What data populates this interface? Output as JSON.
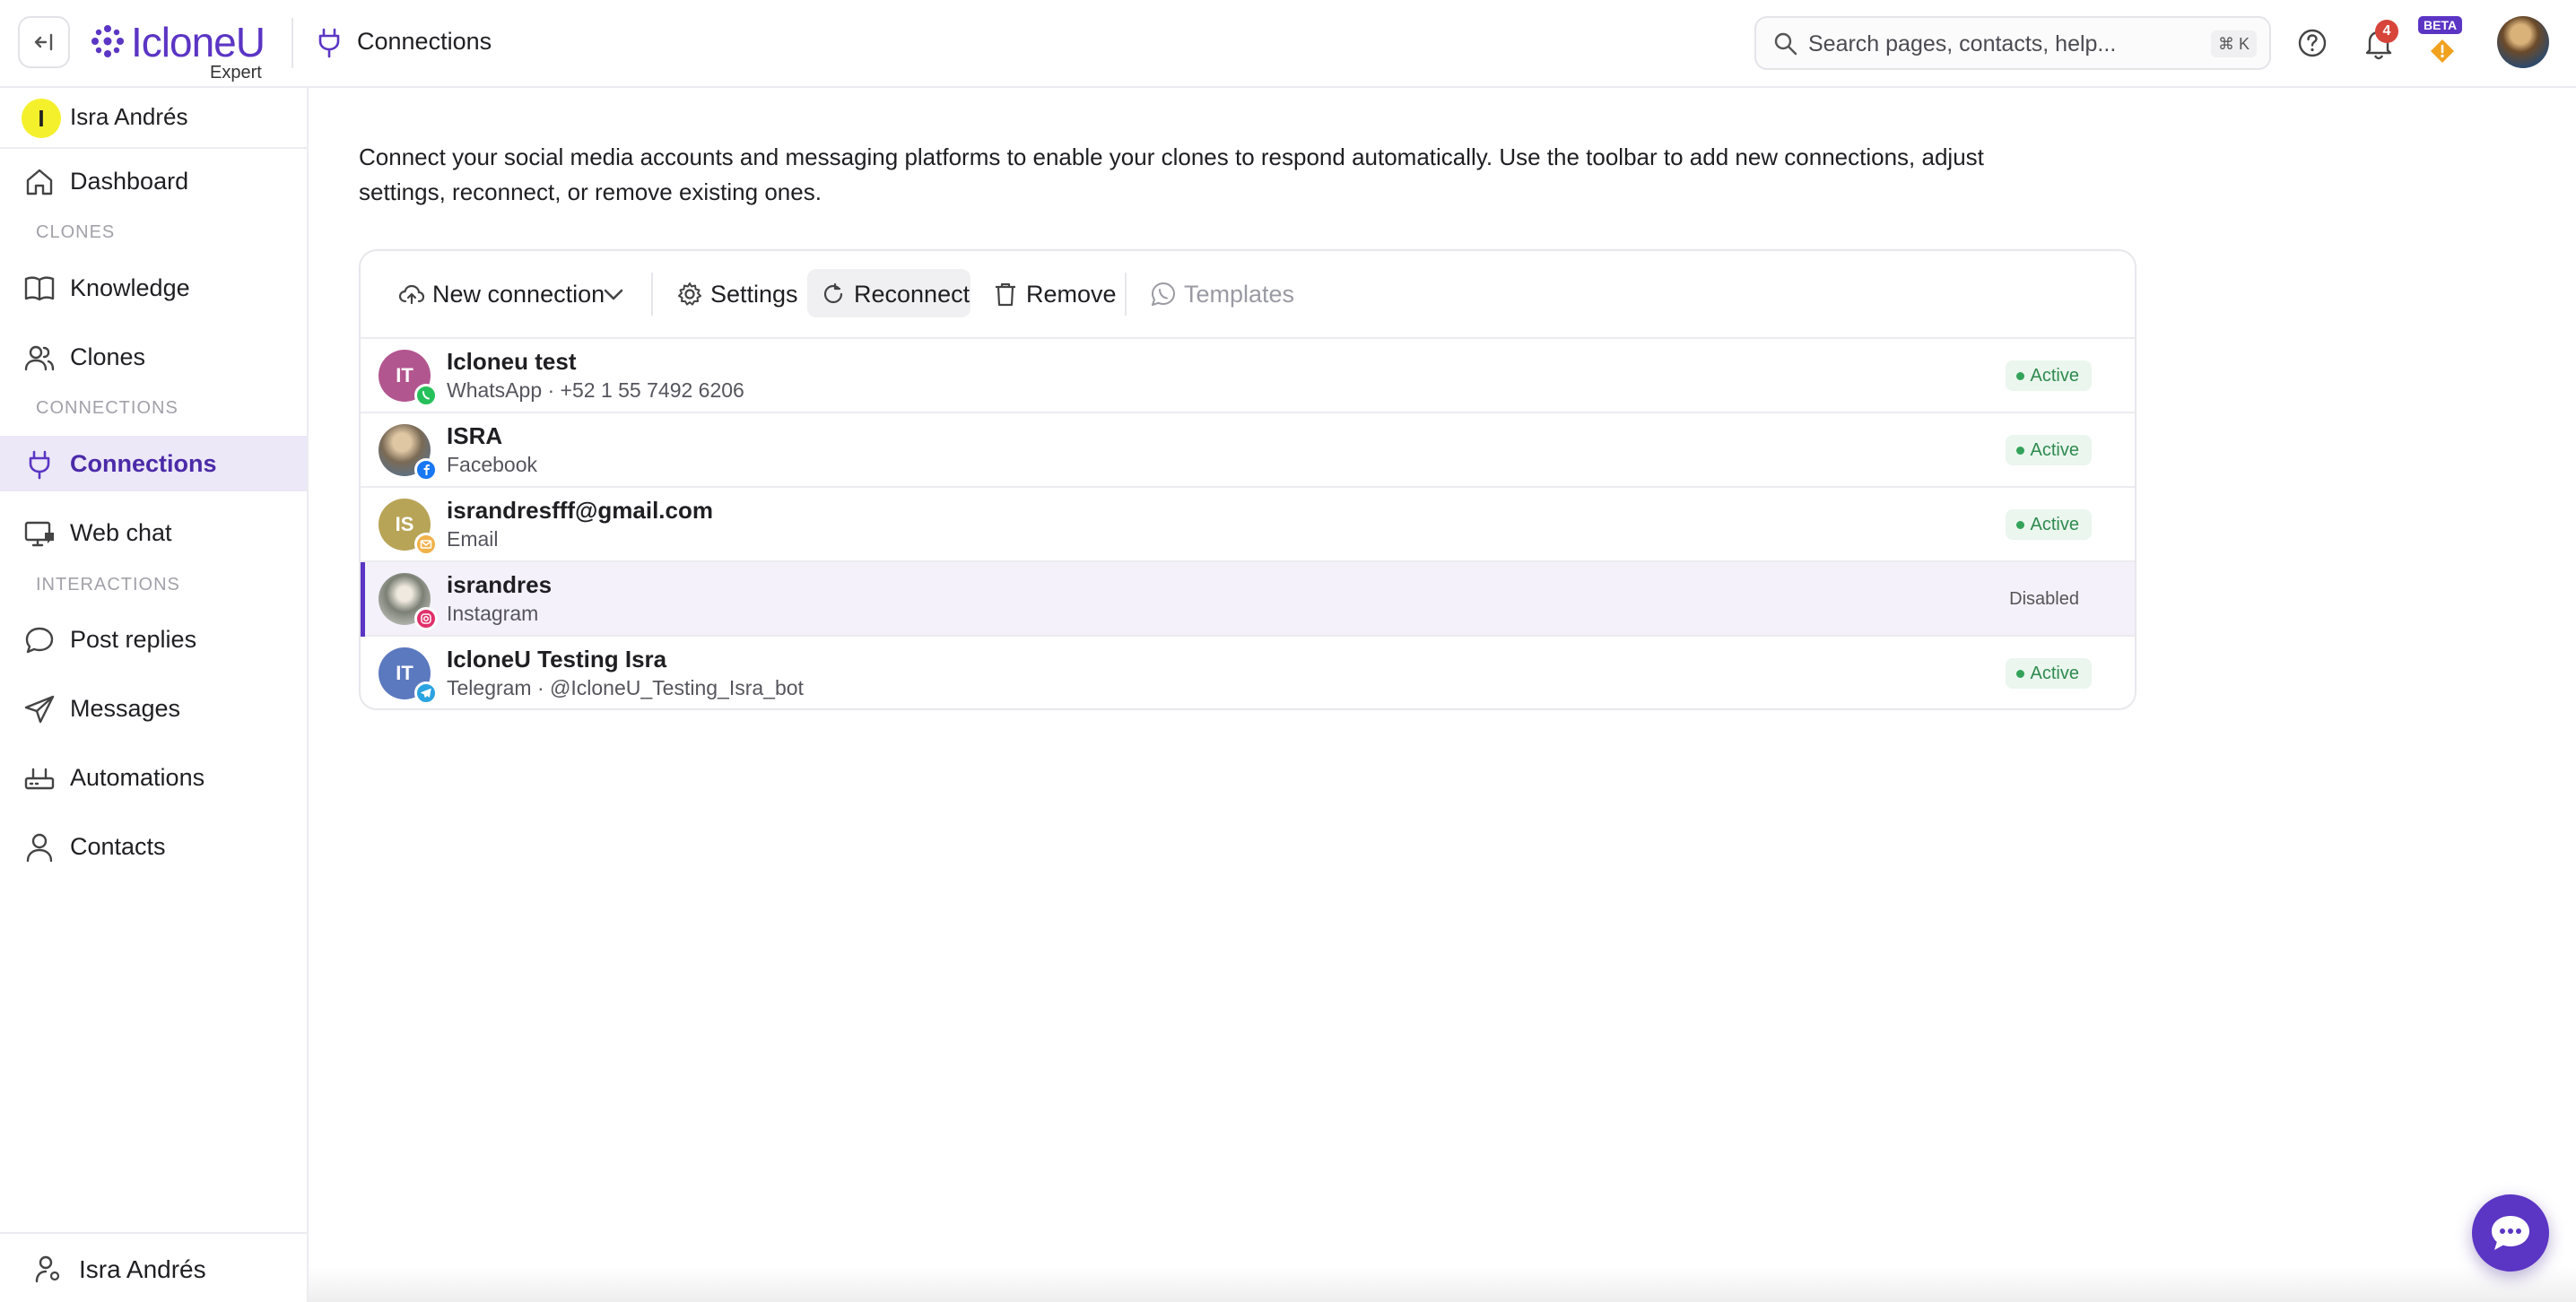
{
  "header": {
    "brand": "IcloneU",
    "brand_sub": "Expert",
    "page_title": "Connections",
    "search": {
      "placeholder": "Search pages, contacts, help...",
      "shortcut": "⌘ K"
    },
    "notifications_count": "4",
    "beta_label": "BETA"
  },
  "sidebar": {
    "profile": {
      "initial": "I",
      "name": "Isra Andrés"
    },
    "items": [
      {
        "label": "Dashboard",
        "icon": "home-icon"
      },
      {
        "section": "CLONES"
      },
      {
        "label": "Knowledge",
        "icon": "book-icon"
      },
      {
        "label": "Clones",
        "icon": "users-icon"
      },
      {
        "section": "CONNECTIONS"
      },
      {
        "label": "Connections",
        "icon": "plug-icon",
        "active": true
      },
      {
        "label": "Web chat",
        "icon": "monitor-chat-icon"
      },
      {
        "section": "INTERACTIONS"
      },
      {
        "label": "Post replies",
        "icon": "comment-icon"
      },
      {
        "label": "Messages",
        "icon": "send-icon"
      },
      {
        "label": "Automations",
        "icon": "router-icon"
      },
      {
        "label": "Contacts",
        "icon": "user-icon"
      }
    ],
    "footer_user": "Isra Andrés"
  },
  "main": {
    "intro": "Connect your social media accounts and messaging platforms to enable your clones to respond automatically. Use the toolbar to add new connections, adjust settings, reconnect, or remove existing ones.",
    "toolbar": {
      "new_connection": "New connection",
      "settings": "Settings",
      "reconnect": "Reconnect",
      "remove": "Remove",
      "templates": "Templates"
    },
    "connections": [
      {
        "initials": "IT",
        "name": "Icloneu test",
        "detail": "WhatsApp · +52 1 55 7492 6206",
        "status": "Active",
        "platform": "whatsapp",
        "avatar_color": "#b2568f"
      },
      {
        "initials": "",
        "name": "ISRA",
        "detail": "Facebook",
        "status": "Active",
        "platform": "facebook",
        "avatar_color": "#6b7d8f"
      },
      {
        "initials": "IS",
        "name": "israndresfff@gmail.com",
        "detail": "Email",
        "status": "Active",
        "platform": "email",
        "avatar_color": "#b8a457"
      },
      {
        "initials": "",
        "name": "israndres",
        "detail": "Instagram",
        "status": "Disabled",
        "platform": "instagram",
        "avatar_color": "#8a8f8a"
      },
      {
        "initials": "IT",
        "name": "IcloneU Testing Isra",
        "detail": "Telegram · @IcloneU_Testing_Isra_bot",
        "status": "Active",
        "platform": "telegram",
        "avatar_color": "#5b79bf"
      }
    ]
  },
  "colors": {
    "brand": "#5b35c4",
    "active_bg": "#ece8f7",
    "status_active": "#2f8a4f",
    "notification": "#d7443a"
  }
}
